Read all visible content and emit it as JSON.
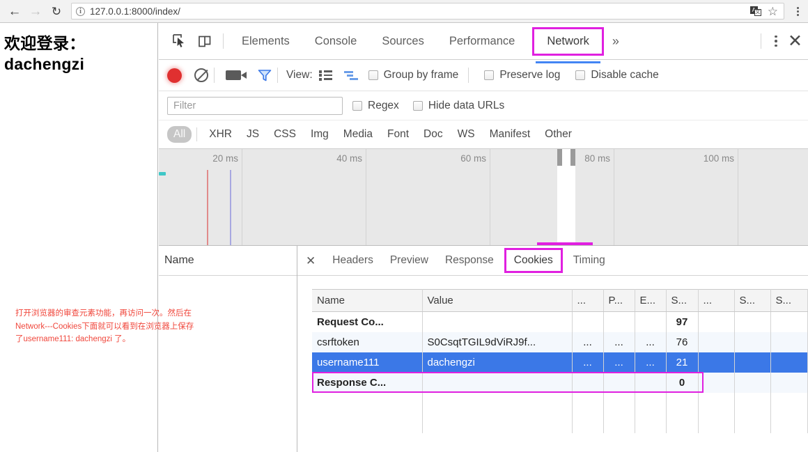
{
  "browser": {
    "back_icon": "arrow-left-icon",
    "forward_icon": "arrow-right-icon",
    "reload_icon": "reload-icon",
    "info_icon_glyph": "i",
    "url": "127.0.0.1:8000/index/",
    "translate_icon": "translate-icon",
    "bookmark_icon": "star-icon",
    "menu_icon": "browser-menu-icon"
  },
  "page": {
    "welcome_line1": "欢迎登录：",
    "welcome_line2": "dachengzi",
    "annotation": "打开浏览器的审查元素功能，再访问一次。然后在Network---Cookies下面就可以看到在浏览器上保存了username111: dachengzi 了。",
    "annotation_color": "#f0473c"
  },
  "devtools": {
    "inspect_icon": "inspect-cursor-icon",
    "device_icon": "device-toolbar-icon",
    "tabs": [
      {
        "label": "Elements",
        "active": false,
        "highlighted": false
      },
      {
        "label": "Console",
        "active": false,
        "highlighted": false
      },
      {
        "label": "Sources",
        "active": false,
        "highlighted": false
      },
      {
        "label": "Performance",
        "active": false,
        "highlighted": false
      },
      {
        "label": "Network",
        "active": true,
        "highlighted": true
      }
    ],
    "more_tabs_glyph": "»",
    "menu_icon": "devtools-menu-icon",
    "close_icon": "close-icon",
    "highlight_color": "#e020e0",
    "active_tab_color": "#4285f4",
    "toolbar": {
      "record_icon": "record-button-icon",
      "clear_icon": "clear-icon",
      "camera_icon": "screenshot-camera-icon",
      "filter_icon": "filter-funnel-icon",
      "view_label": "View:",
      "view_list_icon": "view-list-icon",
      "view_waterfall_icon": "view-waterfall-icon",
      "group_by_frame_label": "Group by frame",
      "group_by_frame_checked": false,
      "preserve_log_label": "Preserve log",
      "preserve_log_checked": false,
      "disable_cache_label": "Disable cache",
      "disable_cache_checked": false
    },
    "filter_row": {
      "filter_placeholder": "Filter",
      "filter_value": "",
      "regex_label": "Regex",
      "regex_checked": false,
      "hide_data_urls_label": "Hide data URLs",
      "hide_data_urls_checked": false
    },
    "resource_types": [
      {
        "label": "All",
        "selected": true
      },
      {
        "label": "XHR",
        "selected": false
      },
      {
        "label": "JS",
        "selected": false
      },
      {
        "label": "CSS",
        "selected": false
      },
      {
        "label": "Img",
        "selected": false
      },
      {
        "label": "Media",
        "selected": false
      },
      {
        "label": "Font",
        "selected": false
      },
      {
        "label": "Doc",
        "selected": false
      },
      {
        "label": "WS",
        "selected": false
      },
      {
        "label": "Manifest",
        "selected": false
      },
      {
        "label": "Other",
        "selected": false
      }
    ],
    "timeline": {
      "ticks": [
        "20 ms",
        "40 ms",
        "60 ms",
        "80 ms",
        "100 ms"
      ],
      "tick_values": [
        20,
        40,
        60,
        80,
        100
      ],
      "max_ms": 110,
      "dom_content_loaded_color": "#e08a8a",
      "load_event_color": "#a8a8e0",
      "request_bar_color": "#3fc7c7",
      "selection_start_ms": 65,
      "selection_end_ms": 72
    },
    "request_list": {
      "column_header": "Name",
      "rows": []
    },
    "detail": {
      "close_icon": "close-icon",
      "tabs": [
        {
          "label": "Headers",
          "active": false,
          "highlighted": false
        },
        {
          "label": "Preview",
          "active": false,
          "highlighted": false
        },
        {
          "label": "Response",
          "active": false,
          "highlighted": false
        },
        {
          "label": "Cookies",
          "active": true,
          "highlighted": true
        },
        {
          "label": "Timing",
          "active": false,
          "highlighted": false
        }
      ]
    },
    "cookies_table": {
      "columns": [
        "Name",
        "Value",
        "...",
        "P...",
        "E...",
        "S...",
        "...",
        "S...",
        "S..."
      ],
      "rows": [
        {
          "type": "group",
          "cells": [
            "Request Co...",
            "",
            "",
            "",
            "",
            "97",
            "",
            "",
            ""
          ]
        },
        {
          "type": "data",
          "selected": false,
          "cells": [
            "csrftoken",
            "S0CsqtTGIL9dViRJ9f...",
            "...",
            "...",
            "...",
            "76",
            "",
            "",
            ""
          ]
        },
        {
          "type": "data",
          "selected": true,
          "cells": [
            "username111",
            "dachengzi",
            "...",
            "...",
            "...",
            "21",
            "",
            "",
            ""
          ]
        },
        {
          "type": "group",
          "cells": [
            "Response C...",
            "",
            "",
            "",
            "",
            "0",
            "",
            "",
            ""
          ]
        }
      ]
    }
  }
}
